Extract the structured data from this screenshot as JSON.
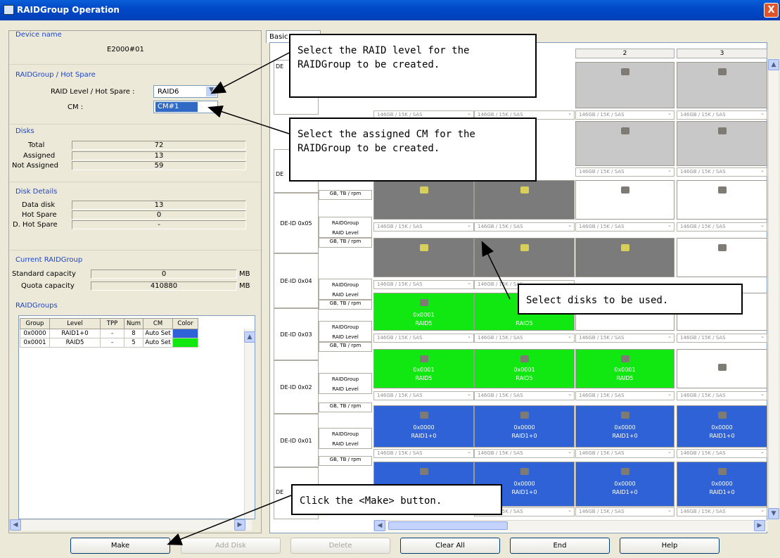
{
  "window": {
    "title": "RAIDGroup Operation",
    "close_glyph": "X"
  },
  "device": {
    "section": "Device name",
    "value": "E2000#01"
  },
  "raid": {
    "section": "RAIDGroup / Hot Spare",
    "level_label": "RAID Level / Hot Spare :",
    "level_value": "RAID6",
    "cm_label": "CM :",
    "cm_value": "CM#1"
  },
  "disks": {
    "section": "Disks",
    "total_label": "Total",
    "total": "72",
    "assigned_label": "Assigned",
    "assigned": "13",
    "not_assigned_label": "Not Assigned",
    "not_assigned": "59"
  },
  "details": {
    "section": "Disk Details",
    "data_label": "Data disk",
    "data": "13",
    "hot_label": "Hot Spare",
    "hot": "0",
    "dhot_label": "D. Hot Spare",
    "dhot": "-"
  },
  "current": {
    "section": "Current RAIDGroup",
    "std_label": "Standard capacity",
    "std": "0",
    "std_unit": "MB",
    "quota_label": "Quota capacity",
    "quota": "410880",
    "quota_unit": "MB"
  },
  "groups": {
    "section": "RAIDGroups",
    "headers": [
      "Group",
      "Level",
      "TPP",
      "Num",
      "CM",
      "Color"
    ],
    "rows": [
      {
        "group": "0x0000",
        "level": "RAID1+0",
        "tpp": "-",
        "num": "8",
        "cm": "Auto Set",
        "color": "#2e62d6"
      },
      {
        "group": "0x0001",
        "level": "RAID5",
        "tpp": "-",
        "num": "5",
        "cm": "Auto Set",
        "color": "#11e811"
      }
    ]
  },
  "tab": {
    "label": "Basic Set"
  },
  "columns": [
    "2",
    "3"
  ],
  "rows": [
    {
      "id": "DE-ID 0x05",
      "sub1": "RAIDGroup",
      "sub2": "RAID Level",
      "sub3": "GB, TB / rpm"
    },
    {
      "id": "DE-ID 0x04",
      "sub1": "RAIDGroup",
      "sub2": "RAID Level",
      "sub3": "GB, TB / rpm"
    },
    {
      "id": "DE-ID 0x03",
      "sub1": "RAIDGroup",
      "sub2": "RAID Level",
      "sub3": "GB, TB / rpm"
    },
    {
      "id": "DE-ID 0x02",
      "sub1": "RAIDGroup",
      "sub2": "RAID Level",
      "sub3": "GB, TB / rpm"
    },
    {
      "id": "DE-ID 0x01",
      "sub1": "RAIDGroup",
      "sub2": "RAID Level",
      "sub3": "GB, TB / rpm"
    }
  ],
  "disk_spec": "146GB / 15K / SAS",
  "group_ids": {
    "g0": "0x0000",
    "g0_level": "RAID1+0",
    "g1": "0x0001",
    "g1_level": "RAID5"
  },
  "buttons": {
    "make": "Make",
    "add_disk": "Add Disk",
    "delete": "Delete",
    "clear_all": "Clear All",
    "end": "End",
    "help": "Help"
  },
  "callouts": {
    "raid_level": "Select the RAID level for the RAIDGroup to be created.",
    "cm": "Select the assigned CM for the RAIDGroup to be created.",
    "disks": "Select disks to be used.",
    "make": "Click the <Make> button."
  },
  "row_label_short": "DE"
}
